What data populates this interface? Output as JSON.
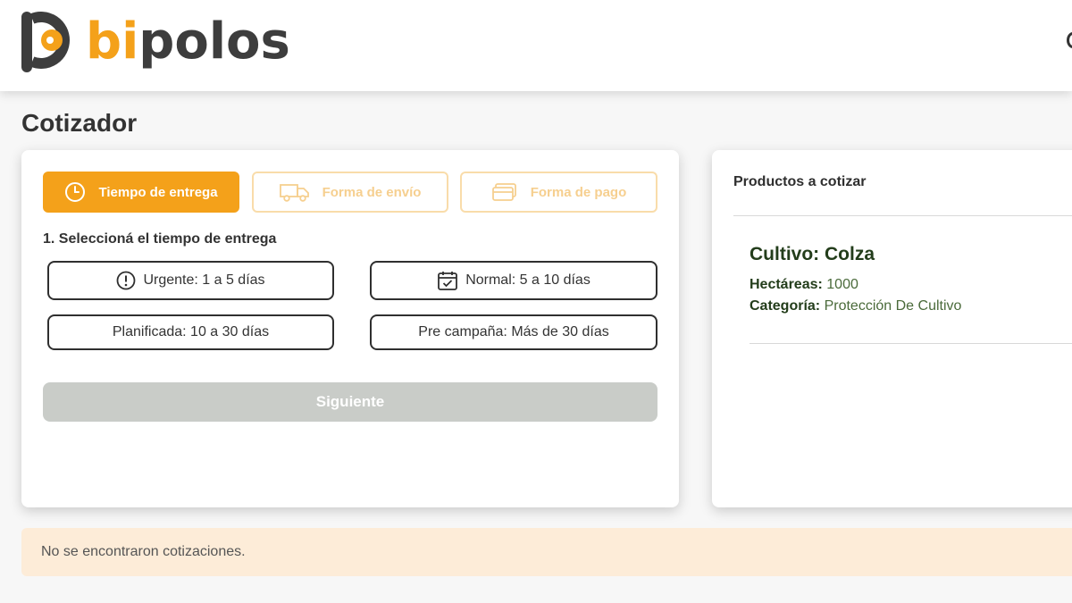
{
  "brand": {
    "name_part_1": "bi",
    "name_part_2": "polos",
    "accent_color": "#f4a11a",
    "dark_color": "#3d3d3d"
  },
  "page": {
    "title": "Cotizador"
  },
  "steps": {
    "tabs": [
      {
        "label": "Tiempo de entrega",
        "icon": "clock-icon",
        "active": true
      },
      {
        "label": "Forma de envío",
        "icon": "truck-icon",
        "active": false
      },
      {
        "label": "Forma de pago",
        "icon": "card-icon",
        "active": false
      }
    ],
    "current_step_label": "1. Seleccioná el tiempo de entrega",
    "options": [
      {
        "label": "Urgente: 1 a 5 días",
        "icon": "alert-circle-icon"
      },
      {
        "label": "Normal: 5 a 10 días",
        "icon": "calendar-check-icon"
      },
      {
        "label": "Planificada: 10 a 30 días"
      },
      {
        "label": "Pre campaña: Más de 30 días"
      }
    ],
    "next_label": "Siguiente"
  },
  "products": {
    "title": "Productos a cotizar",
    "items": [
      {
        "crop_label": "Cultivo: Colza",
        "hectares_key": "Hectáreas:",
        "hectares_value": "1000",
        "category_key": "Categoría:",
        "category_value": "Protección De Cultivo"
      }
    ]
  },
  "quotes": {
    "empty_message": "No se encontraron cotizaciones."
  }
}
